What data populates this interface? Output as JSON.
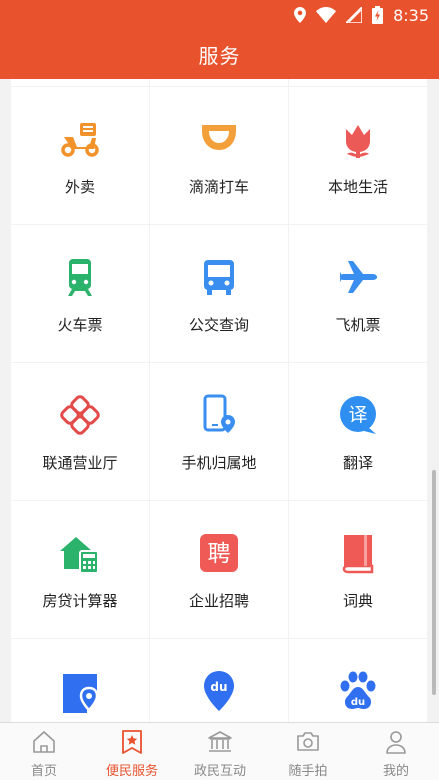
{
  "status_bar": {
    "time": "8:35"
  },
  "header": {
    "title": "服务"
  },
  "services": [
    {
      "label": "外卖",
      "icon": "delivery-scooter-icon",
      "color": "#f2922b"
    },
    {
      "label": "滴滴打车",
      "icon": "didi-logo-icon",
      "color": "#f4a03a"
    },
    {
      "label": "本地生活",
      "icon": "lotus-flower-icon",
      "color": "#ec5a57"
    },
    {
      "label": "火车票",
      "icon": "train-icon",
      "color": "#2bb36b"
    },
    {
      "label": "公交查询",
      "icon": "bus-icon",
      "color": "#3a8ef0"
    },
    {
      "label": "飞机票",
      "icon": "airplane-icon",
      "color": "#3a8ef0"
    },
    {
      "label": "联通营业厅",
      "icon": "china-unicom-knot-icon",
      "color": "#e34a4a"
    },
    {
      "label": "手机归属地",
      "icon": "phone-location-icon",
      "color": "#3a8ef0"
    },
    {
      "label": "翻译",
      "icon": "translate-bubble-icon",
      "color": "#2f8ff0",
      "glyph": "译"
    },
    {
      "label": "房贷计算器",
      "icon": "house-calculator-icon",
      "color": "#2bb36b"
    },
    {
      "label": "企业招聘",
      "icon": "recruit-icon",
      "color": "#ef5a57",
      "glyph": "聘"
    },
    {
      "label": "词典",
      "icon": "dictionary-book-icon",
      "color": "#ef5a57"
    },
    {
      "label": "",
      "icon": "map-location-icon",
      "color": "#2f6ff0"
    },
    {
      "label": "",
      "icon": "du-location-pin-icon",
      "color": "#2f6ff0",
      "glyph": "du"
    },
    {
      "label": "",
      "icon": "baidu-paw-icon",
      "color": "#2f6ff0",
      "glyph": "du"
    }
  ],
  "tabs": [
    {
      "label": "首页",
      "icon": "home-icon",
      "active": false
    },
    {
      "label": "便民服务",
      "icon": "star-bookmark-icon",
      "active": true
    },
    {
      "label": "政民互动",
      "icon": "government-building-icon",
      "active": false
    },
    {
      "label": "随手拍",
      "icon": "camera-icon",
      "active": false
    },
    {
      "label": "我的",
      "icon": "user-icon",
      "active": false
    }
  ],
  "colors": {
    "primary": "#e8522d",
    "tab_inactive": "#888888"
  }
}
